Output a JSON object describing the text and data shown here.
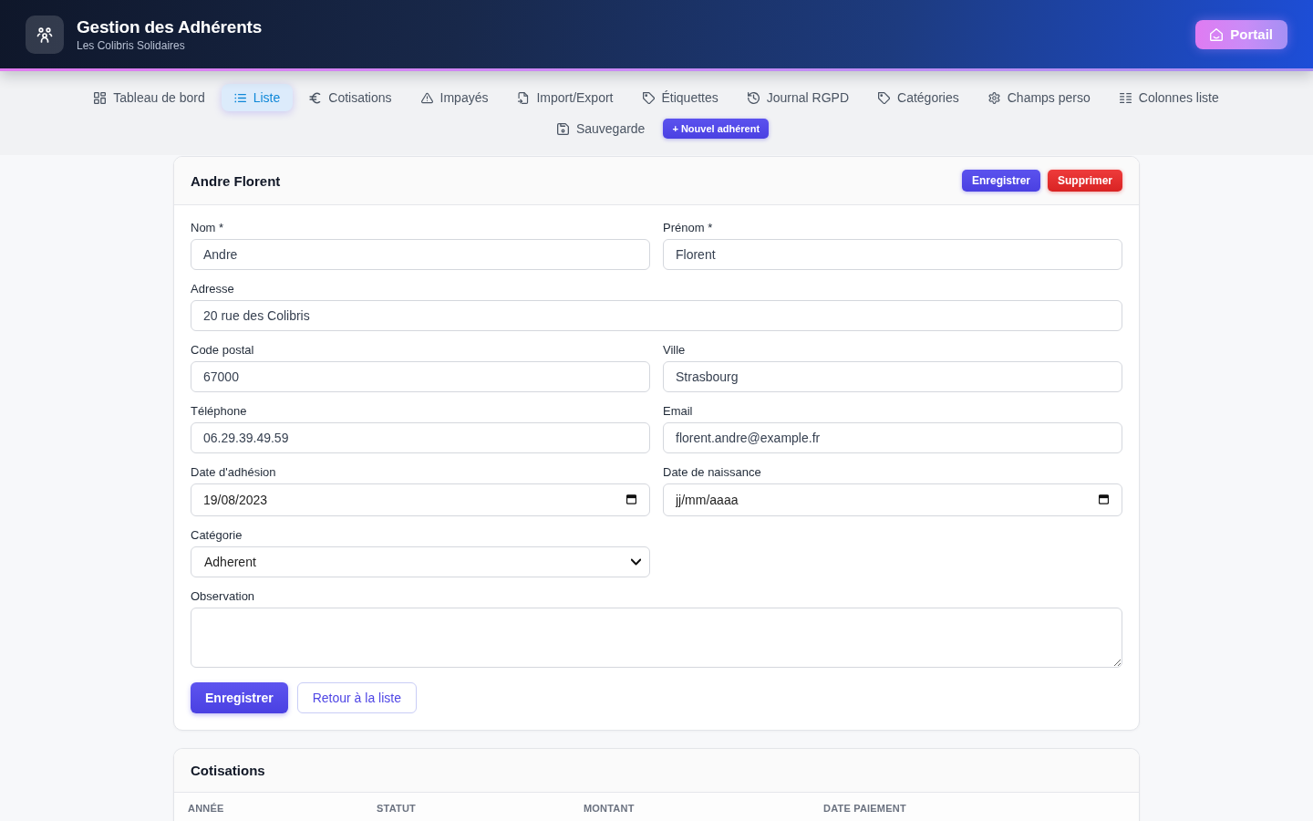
{
  "header": {
    "title": "Gestion des Adhérents",
    "subtitle": "Les Colibris Solidaires",
    "portal_button": "Portail"
  },
  "nav": {
    "tabs": [
      {
        "label": "Tableau de bord",
        "selected": false
      },
      {
        "label": "Liste",
        "selected": true
      },
      {
        "label": "Cotisations",
        "selected": false
      },
      {
        "label": "Impayés",
        "selected": false
      },
      {
        "label": "Import/Export",
        "selected": false
      },
      {
        "label": "Étiquettes",
        "selected": false
      },
      {
        "label": "Journal RGPD",
        "selected": false
      },
      {
        "label": "Catégories",
        "selected": false
      },
      {
        "label": "Champs perso",
        "selected": false
      },
      {
        "label": "Colonnes liste",
        "selected": false
      },
      {
        "label": "Sauvegarde",
        "selected": false
      }
    ],
    "new_member_button": "+ Nouvel adhérent"
  },
  "member_card": {
    "title": "Andre Florent",
    "header_buttons": [
      {
        "label": "Enregistrer",
        "kind": "primary"
      },
      {
        "label": "Supprimer",
        "kind": "danger"
      }
    ],
    "form_rows": [
      [
        {
          "label": "Nom *",
          "kind": "text",
          "value": "Andre"
        },
        {
          "label": "Prénom *",
          "kind": "text",
          "value": "Florent"
        }
      ],
      [
        {
          "label": "Adresse",
          "kind": "text",
          "value": "20 rue des Colibris"
        }
      ],
      [
        {
          "label": "Code postal",
          "kind": "text",
          "value": "67000"
        },
        {
          "label": "Ville",
          "kind": "text",
          "value": "Strasbourg"
        }
      ],
      [
        {
          "label": "Téléphone",
          "kind": "text",
          "value": "06.29.39.49.59"
        },
        {
          "label": "Email",
          "kind": "text",
          "value": "florent.andre@example.fr"
        }
      ],
      [
        {
          "label": "Date d'adhésion",
          "kind": "date",
          "value": "19/08/2023"
        },
        {
          "label": "Date de naissance",
          "kind": "date",
          "placeholder": "jj/mm/aaaa"
        }
      ],
      [
        {
          "label": "Catégorie",
          "kind": "select",
          "value": "Adherent"
        }
      ],
      [
        {
          "label": "Observation",
          "kind": "textarea"
        }
      ]
    ],
    "footer_buttons": [
      {
        "label": "Enregistrer",
        "kind": "primary"
      },
      {
        "label": "Retour à la liste",
        "kind": "outline"
      }
    ]
  },
  "cotisations_card": {
    "title": "Cotisations",
    "table": {
      "columns": [
        "ANNÉE",
        "STATUT",
        "MONTANT",
        "DATE PAIEMENT"
      ]
    }
  }
}
